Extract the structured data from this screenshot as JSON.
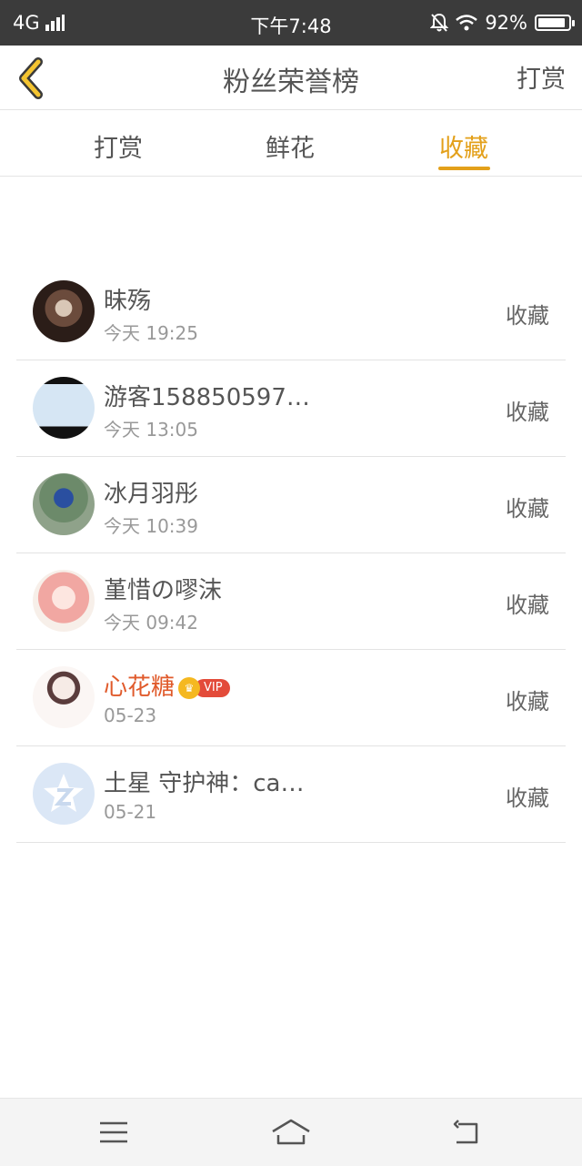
{
  "status_bar": {
    "network": "4G",
    "time": "下午7:48",
    "battery_text": "92%",
    "battery_level": 0.92
  },
  "navbar": {
    "title": "粉丝荣誉榜",
    "right_action": "打赏",
    "accent": "#e3a01a"
  },
  "tabs": [
    {
      "label": "打赏",
      "active": false
    },
    {
      "label": "鲜花",
      "active": false
    },
    {
      "label": "收藏",
      "active": true
    }
  ],
  "list": [
    {
      "name": "昧殇",
      "time": "今天 19:25",
      "action": "收藏",
      "vip": false
    },
    {
      "name": "游客158850597…",
      "time": "今天 13:05",
      "action": "收藏",
      "vip": false
    },
    {
      "name": "冰月羽彤",
      "time": "今天 10:39",
      "action": "收藏",
      "vip": false
    },
    {
      "name": "堇惜の嘐沫",
      "time": "今天 09:42",
      "action": "收藏",
      "vip": false
    },
    {
      "name": "心花糖",
      "time": "05-23",
      "action": "收藏",
      "vip": true,
      "vip_label": "VIP"
    },
    {
      "name": "土星 守护神：ca…",
      "time": "05-21",
      "action": "收藏",
      "vip": false
    }
  ]
}
